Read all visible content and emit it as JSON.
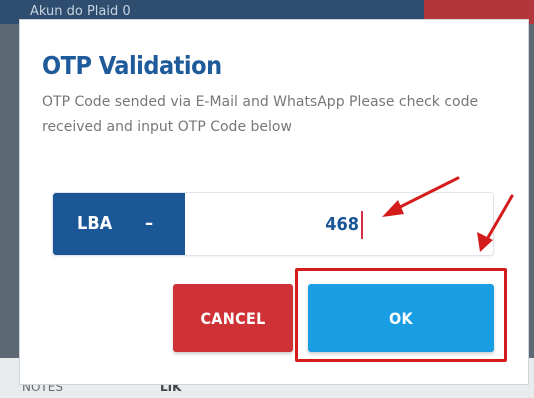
{
  "background": {
    "header_title": "Akun do Plaid 0",
    "footer_label": "NOTES",
    "footer_value": "LIK"
  },
  "dialog": {
    "title": "OTP Validation",
    "message": "OTP Code sended via E-Mail and WhatsApp Please check code received and input OTP Code below",
    "otp_prefix": "LBA",
    "otp_separator": "–",
    "otp_value": "468",
    "buttons": {
      "cancel": "CANCEL",
      "ok": "OK"
    }
  },
  "colors": {
    "title": "#1f5a9b",
    "prefix_bg": "#1b5697",
    "cancel_bg": "#cf3236",
    "ok_bg": "#199ee3",
    "annotation": "#d41c1c"
  },
  "annotations": {
    "arrow_icon": "red-arrow",
    "highlight": "red-box-around-ok-button"
  }
}
